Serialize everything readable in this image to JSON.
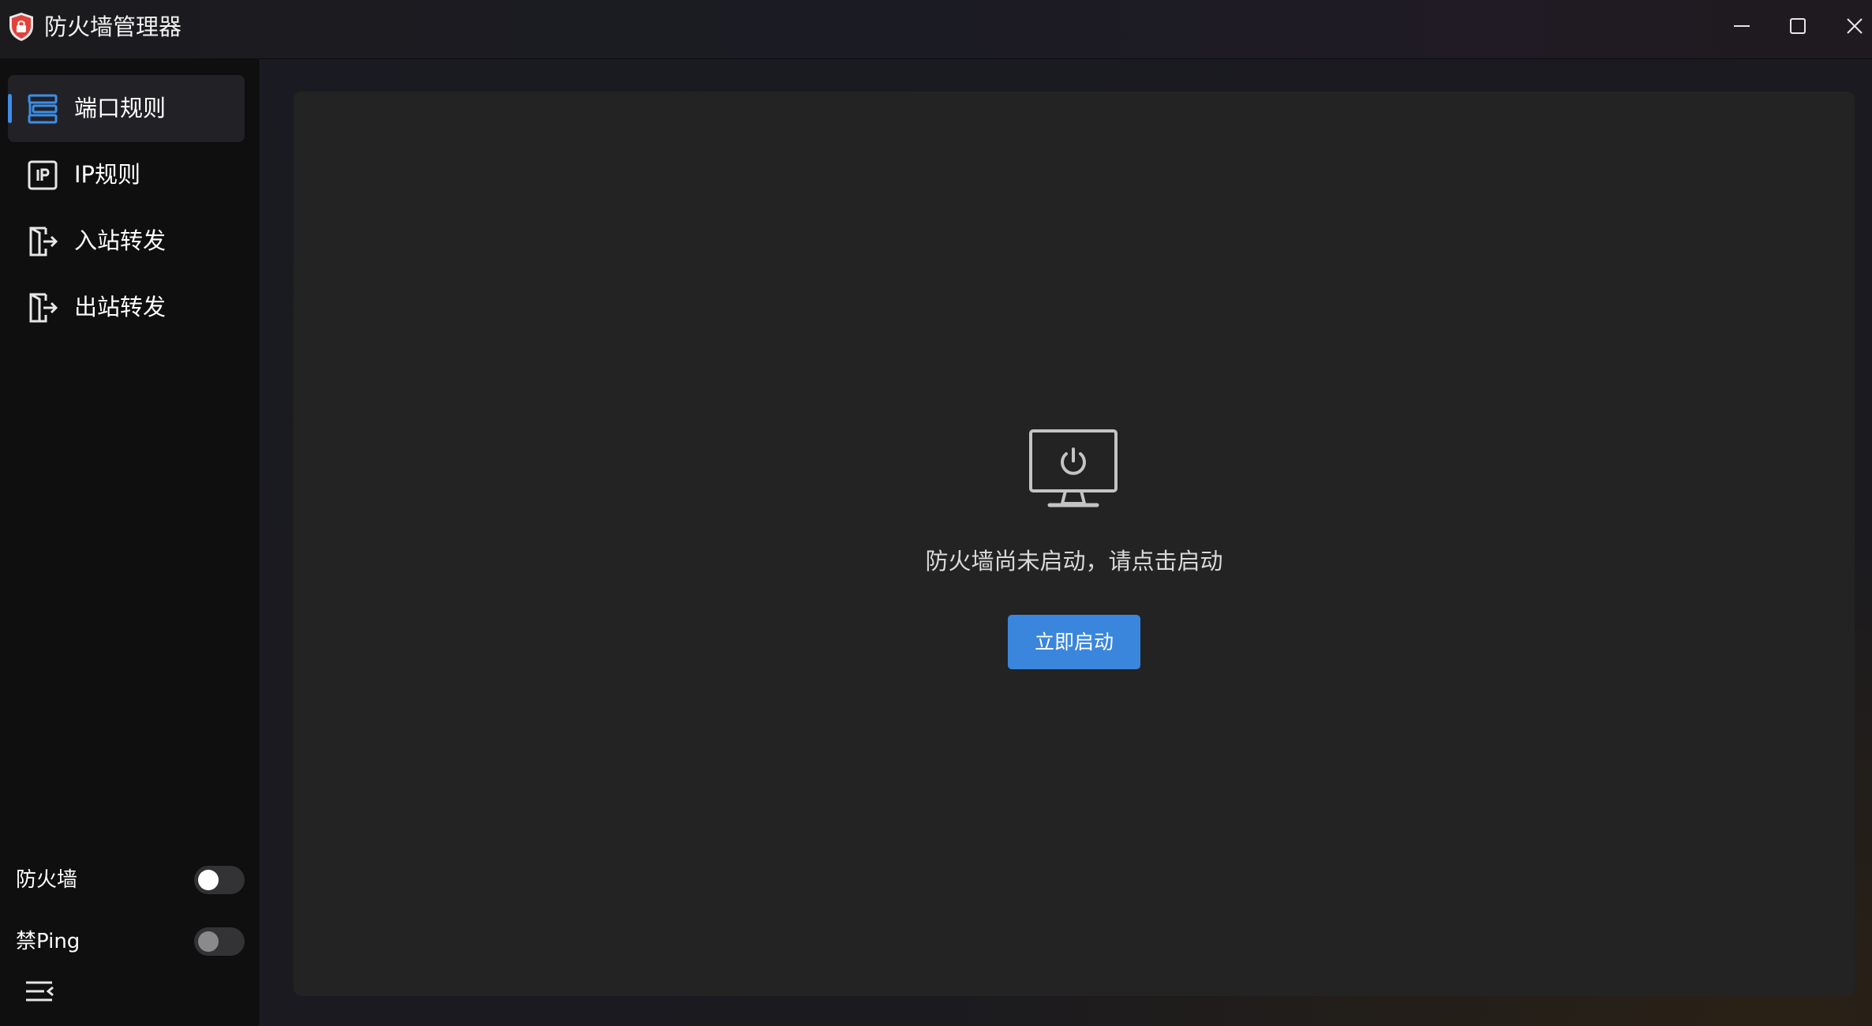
{
  "window": {
    "title": "防火墙管理器"
  },
  "sidebar": {
    "items": [
      {
        "label": "端口规则",
        "icon": "port-rules-icon",
        "active": true
      },
      {
        "label": "IP规则",
        "icon": "ip-icon",
        "active": false
      },
      {
        "label": "入站转发",
        "icon": "inbound-forward-icon",
        "active": false
      },
      {
        "label": "出站转发",
        "icon": "outbound-forward-icon",
        "active": false
      }
    ],
    "toggles": [
      {
        "label": "防火墙",
        "on": false
      },
      {
        "label": "禁Ping",
        "on": false
      }
    ]
  },
  "main": {
    "empty_state": {
      "icon": "monitor-power-icon",
      "message": "防火墙尚未启动，请点击启动",
      "button_label": "立即启动"
    }
  },
  "colors": {
    "accent": "#3a86dc",
    "sidebar_bg": "#0f0f10",
    "card_bg": "#232323"
  }
}
